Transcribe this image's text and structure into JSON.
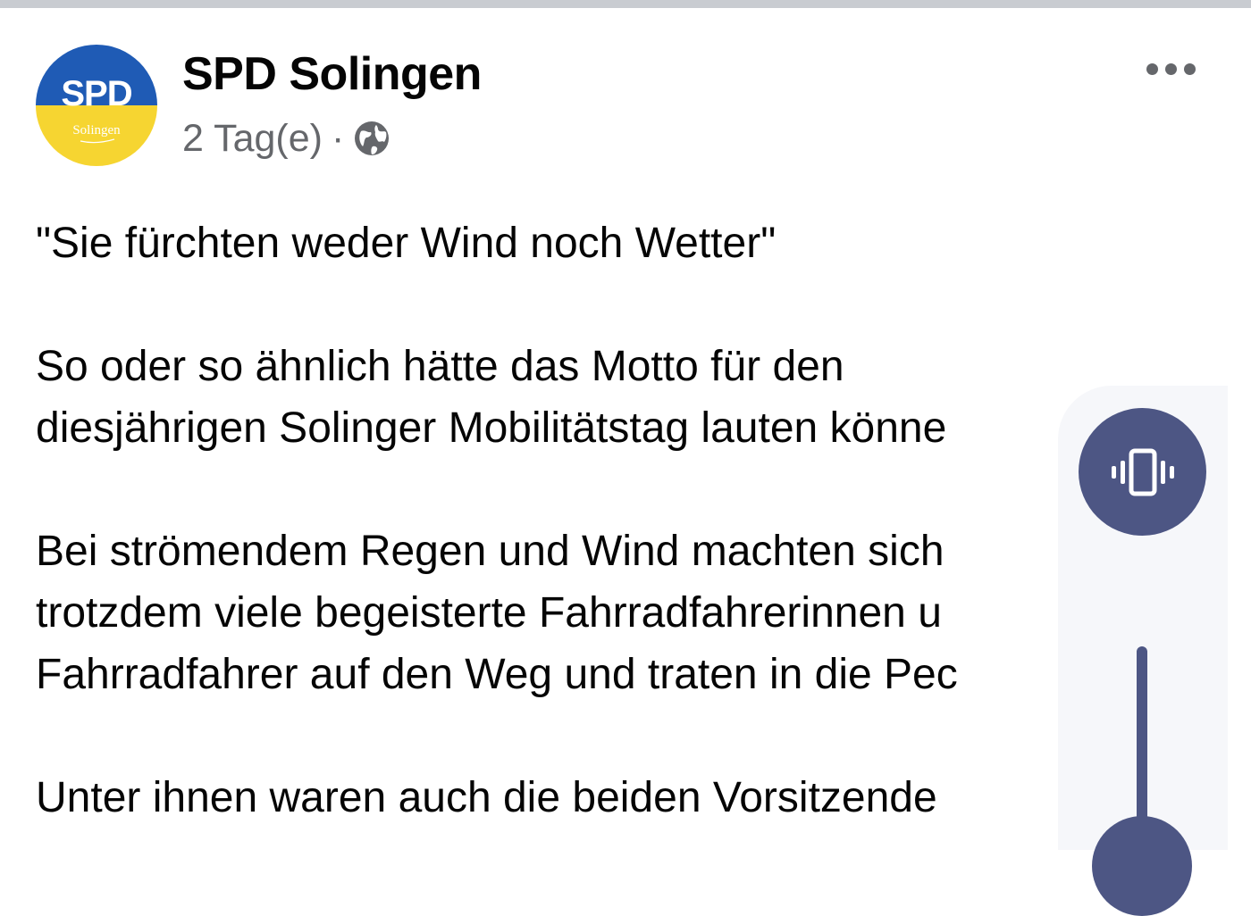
{
  "post": {
    "page_name": "SPD Solingen",
    "time": "2 Tag(e)",
    "separator": "·",
    "privacy_icon": "globe-icon",
    "more_icon": "more-options-icon",
    "avatar": {
      "logo_text": "SPD",
      "subtitle": "Solingen",
      "colors": {
        "top": "#1f5bb5",
        "bottom": "#f6d531",
        "logo_text": "#ffffff"
      }
    },
    "paragraphs": [
      {
        "lines": [
          "\"Sie fürchten weder Wind noch Wetter\""
        ]
      },
      {
        "lines": [
          "So oder so ähnlich hätte das Motto für den",
          "diesjährigen Solinger Mobilitätstag lauten könne"
        ]
      },
      {
        "lines": [
          "Bei strömendem Regen und Wind machten sich",
          "trotzdem viele begeisterte Fahrradfahrerinnen u",
          "Fahrradfahrer auf den Weg und traten in die Pec"
        ]
      },
      {
        "lines": [
          "Unter ihnen waren auch die beiden Vorsitzende"
        ]
      }
    ]
  },
  "volume_overlay": {
    "mode_icon": "vibrate-icon",
    "accent_color": "#4d5684",
    "panel_color": "#f6f7fa"
  }
}
